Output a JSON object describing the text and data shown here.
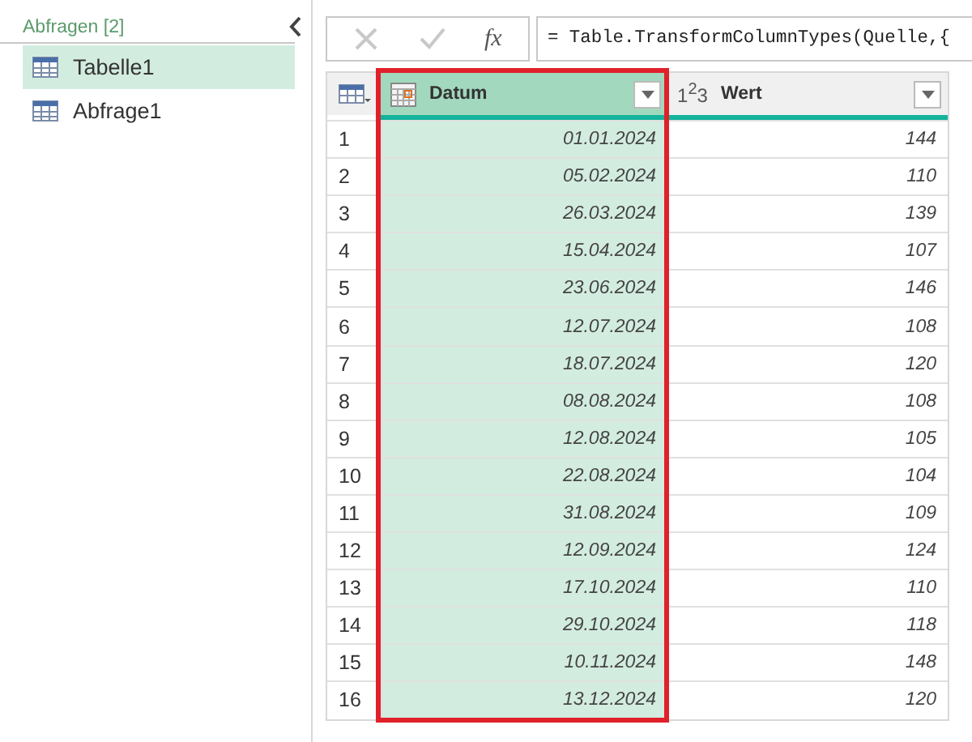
{
  "queries": {
    "title": "Abfragen [2]",
    "items": [
      {
        "label": "Tabelle1",
        "selected": true
      },
      {
        "label": "Abfrage1",
        "selected": false
      }
    ]
  },
  "formula_bar": {
    "fx": "fx",
    "formula": "= Table.TransformColumnTypes(Quelle,{"
  },
  "table": {
    "columns": [
      {
        "name": "Datum",
        "kind": "date",
        "selected": true
      },
      {
        "name": "Wert",
        "kind": "number",
        "type_label": "1$^{2}$3",
        "selected": false
      }
    ],
    "rows": [
      [
        "1",
        "01.01.2024",
        "144"
      ],
      [
        "2",
        "05.02.2024",
        "110"
      ],
      [
        "3",
        "26.03.2024",
        "139"
      ],
      [
        "4",
        "15.04.2024",
        "107"
      ],
      [
        "5",
        "23.06.2024",
        "146"
      ],
      [
        "6",
        "12.07.2024",
        "108"
      ],
      [
        "7",
        "18.07.2024",
        "120"
      ],
      [
        "8",
        "08.08.2024",
        "108"
      ],
      [
        "9",
        "12.08.2024",
        "105"
      ],
      [
        "10",
        "22.08.2024",
        "104"
      ],
      [
        "11",
        "31.08.2024",
        "109"
      ],
      [
        "12",
        "12.09.2024",
        "124"
      ],
      [
        "13",
        "17.10.2024",
        "110"
      ],
      [
        "14",
        "29.10.2024",
        "118"
      ],
      [
        "15",
        "10.11.2024",
        "148"
      ],
      [
        "16",
        "13.12.2024",
        "120"
      ]
    ]
  }
}
